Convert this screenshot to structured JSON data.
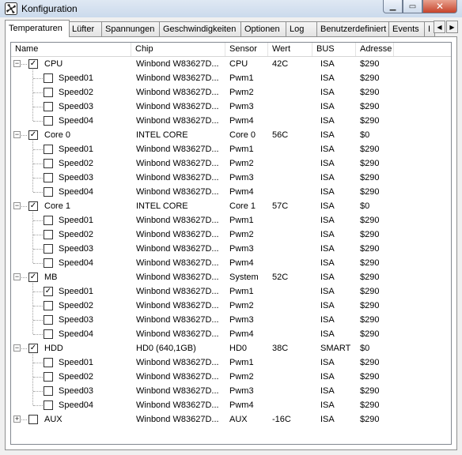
{
  "window": {
    "title": "Konfiguration",
    "icon": "fan-icon"
  },
  "caption_buttons": {
    "minimize": "▁",
    "maximize": "▭",
    "close": "✕"
  },
  "tabs": [
    {
      "label": "Temperaturen",
      "active": true
    },
    {
      "label": "Lüfter"
    },
    {
      "label": "Spannungen"
    },
    {
      "label": "Geschwindigkeiten"
    },
    {
      "label": "Optionen"
    },
    {
      "label": "Log"
    },
    {
      "label": "Benutzerdefiniert"
    },
    {
      "label": "Events"
    },
    {
      "label": "I"
    }
  ],
  "tab_scroll": {
    "left": "◀",
    "right": "▶"
  },
  "columns": [
    "Name",
    "Chip",
    "Sensor",
    "Wert",
    "BUS",
    "Adresse"
  ],
  "rows": [
    {
      "level": 0,
      "expander": "−",
      "checked": true,
      "name": "CPU",
      "chip": "Winbond W83627D...",
      "sensor": "CPU",
      "wert": "42C",
      "bus": "ISA",
      "adresse": "$290"
    },
    {
      "level": 1,
      "checked": false,
      "name": "Speed01",
      "chip": "Winbond W83627D...",
      "sensor": "Pwm1",
      "wert": "",
      "bus": "ISA",
      "adresse": "$290"
    },
    {
      "level": 1,
      "checked": false,
      "name": "Speed02",
      "chip": "Winbond W83627D...",
      "sensor": "Pwm2",
      "wert": "",
      "bus": "ISA",
      "adresse": "$290"
    },
    {
      "level": 1,
      "checked": false,
      "name": "Speed03",
      "chip": "Winbond W83627D...",
      "sensor": "Pwm3",
      "wert": "",
      "bus": "ISA",
      "adresse": "$290"
    },
    {
      "level": 1,
      "checked": false,
      "name": "Speed04",
      "chip": "Winbond W83627D...",
      "sensor": "Pwm4",
      "wert": "",
      "bus": "ISA",
      "adresse": "$290"
    },
    {
      "level": 0,
      "expander": "−",
      "checked": true,
      "name": "Core 0",
      "chip": "INTEL CORE",
      "sensor": "Core 0",
      "wert": "56C",
      "bus": "ISA",
      "adresse": "$0"
    },
    {
      "level": 1,
      "checked": false,
      "name": "Speed01",
      "chip": "Winbond W83627D...",
      "sensor": "Pwm1",
      "wert": "",
      "bus": "ISA",
      "adresse": "$290"
    },
    {
      "level": 1,
      "checked": false,
      "name": "Speed02",
      "chip": "Winbond W83627D...",
      "sensor": "Pwm2",
      "wert": "",
      "bus": "ISA",
      "adresse": "$290"
    },
    {
      "level": 1,
      "checked": false,
      "name": "Speed03",
      "chip": "Winbond W83627D...",
      "sensor": "Pwm3",
      "wert": "",
      "bus": "ISA",
      "adresse": "$290"
    },
    {
      "level": 1,
      "checked": false,
      "name": "Speed04",
      "chip": "Winbond W83627D...",
      "sensor": "Pwm4",
      "wert": "",
      "bus": "ISA",
      "adresse": "$290"
    },
    {
      "level": 0,
      "expander": "−",
      "checked": true,
      "name": "Core 1",
      "chip": "INTEL CORE",
      "sensor": "Core 1",
      "wert": "57C",
      "bus": "ISA",
      "adresse": "$0"
    },
    {
      "level": 1,
      "checked": false,
      "name": "Speed01",
      "chip": "Winbond W83627D...",
      "sensor": "Pwm1",
      "wert": "",
      "bus": "ISA",
      "adresse": "$290"
    },
    {
      "level": 1,
      "checked": false,
      "name": "Speed02",
      "chip": "Winbond W83627D...",
      "sensor": "Pwm2",
      "wert": "",
      "bus": "ISA",
      "adresse": "$290"
    },
    {
      "level": 1,
      "checked": false,
      "name": "Speed03",
      "chip": "Winbond W83627D...",
      "sensor": "Pwm3",
      "wert": "",
      "bus": "ISA",
      "adresse": "$290"
    },
    {
      "level": 1,
      "checked": false,
      "name": "Speed04",
      "chip": "Winbond W83627D...",
      "sensor": "Pwm4",
      "wert": "",
      "bus": "ISA",
      "adresse": "$290"
    },
    {
      "level": 0,
      "expander": "−",
      "checked": true,
      "name": "MB",
      "chip": "Winbond W83627D...",
      "sensor": "System",
      "wert": "52C",
      "bus": "ISA",
      "adresse": "$290"
    },
    {
      "level": 1,
      "checked": true,
      "name": "Speed01",
      "chip": "Winbond W83627D...",
      "sensor": "Pwm1",
      "wert": "",
      "bus": "ISA",
      "adresse": "$290"
    },
    {
      "level": 1,
      "checked": false,
      "name": "Speed02",
      "chip": "Winbond W83627D...",
      "sensor": "Pwm2",
      "wert": "",
      "bus": "ISA",
      "adresse": "$290"
    },
    {
      "level": 1,
      "checked": false,
      "name": "Speed03",
      "chip": "Winbond W83627D...",
      "sensor": "Pwm3",
      "wert": "",
      "bus": "ISA",
      "adresse": "$290"
    },
    {
      "level": 1,
      "checked": false,
      "name": "Speed04",
      "chip": "Winbond W83627D...",
      "sensor": "Pwm4",
      "wert": "",
      "bus": "ISA",
      "adresse": "$290"
    },
    {
      "level": 0,
      "expander": "−",
      "checked": true,
      "name": "HDD",
      "chip": "HD0 (640,1GB)",
      "sensor": "HD0",
      "wert": "38C",
      "bus": "SMART",
      "adresse": "$0"
    },
    {
      "level": 1,
      "checked": false,
      "name": "Speed01",
      "chip": "Winbond W83627D...",
      "sensor": "Pwm1",
      "wert": "",
      "bus": "ISA",
      "adresse": "$290"
    },
    {
      "level": 1,
      "checked": false,
      "name": "Speed02",
      "chip": "Winbond W83627D...",
      "sensor": "Pwm2",
      "wert": "",
      "bus": "ISA",
      "adresse": "$290"
    },
    {
      "level": 1,
      "checked": false,
      "name": "Speed03",
      "chip": "Winbond W83627D...",
      "sensor": "Pwm3",
      "wert": "",
      "bus": "ISA",
      "adresse": "$290"
    },
    {
      "level": 1,
      "checked": false,
      "name": "Speed04",
      "chip": "Winbond W83627D...",
      "sensor": "Pwm4",
      "wert": "",
      "bus": "ISA",
      "adresse": "$290"
    },
    {
      "level": 0,
      "expander": "+",
      "checked": false,
      "name": "AUX",
      "chip": "Winbond W83627D...",
      "sensor": "AUX",
      "wert": "-16C",
      "bus": "ISA",
      "adresse": "$290"
    }
  ]
}
